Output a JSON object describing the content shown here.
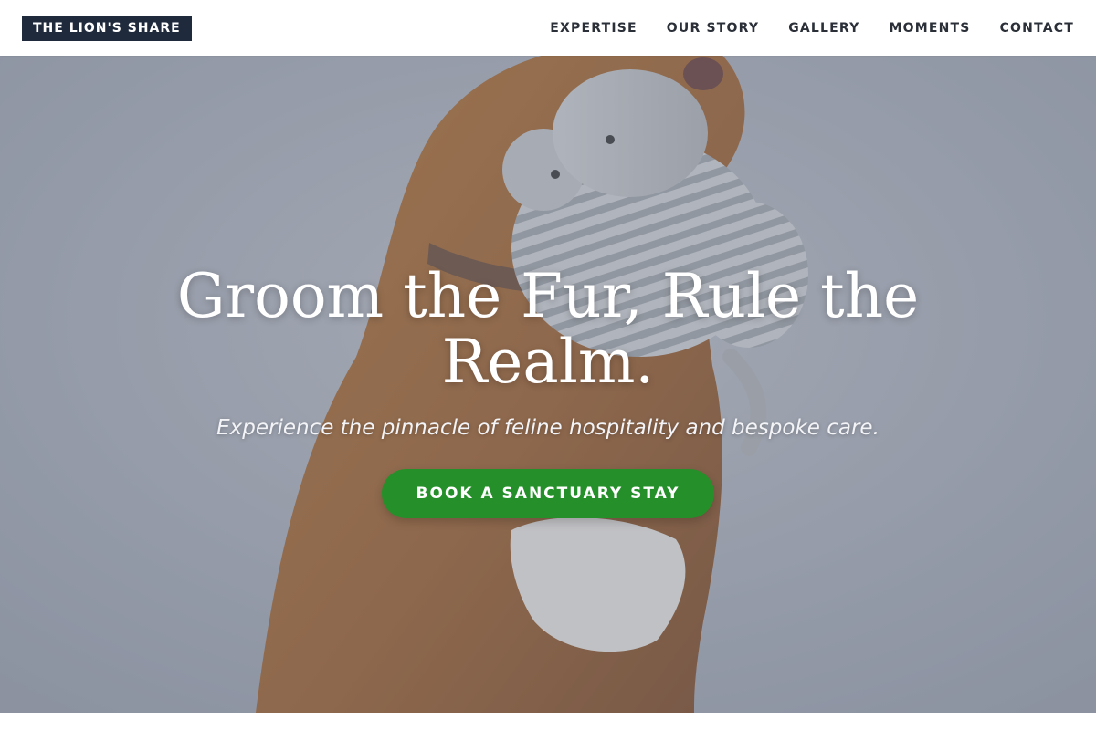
{
  "header": {
    "logo": "THE LION'S SHARE",
    "nav": [
      {
        "label": "EXPERTISE"
      },
      {
        "label": "OUR STORY"
      },
      {
        "label": "GALLERY"
      },
      {
        "label": "MOMENTS"
      },
      {
        "label": "CONTACT"
      }
    ]
  },
  "hero": {
    "title": "Groom the Fur, Rule the Realm.",
    "subtitle": "Experience the pinnacle of feline hospitality and bespoke care.",
    "cta_label": "BOOK A SANCTUARY STAY"
  },
  "colors": {
    "logo_bg": "#1f2b3d",
    "cta_bg": "#25902a",
    "nav_text": "#2a2f38"
  }
}
